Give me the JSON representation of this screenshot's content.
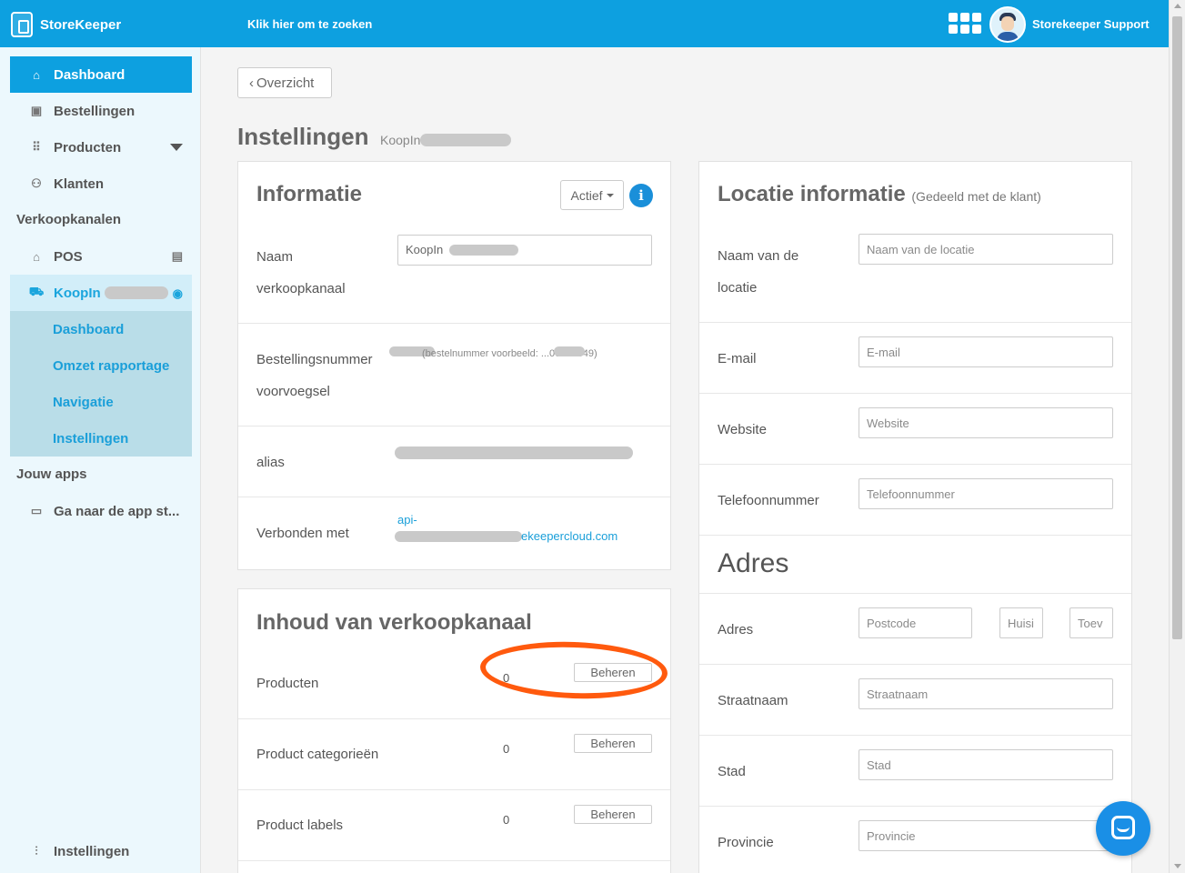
{
  "topbar": {
    "brand": "StoreKeeper",
    "search_link": "Klik hier om te zoeken",
    "user": "Storekeeper Support"
  },
  "sidebar": {
    "items": [
      {
        "label": "Dashboard",
        "icon": "home-icon"
      },
      {
        "label": "Bestellingen",
        "icon": "orders-icon"
      },
      {
        "label": "Producten",
        "icon": "grid-icon"
      },
      {
        "label": "Klanten",
        "icon": "users-icon"
      }
    ],
    "section_sales": "Verkoopkanalen",
    "pos": "POS",
    "channel": "KoopIn",
    "channel_sub": [
      "Dashboard",
      "Omzet rapportage",
      "Navigatie",
      "Instellingen"
    ],
    "section_apps": "Jouw apps",
    "app_store": "Ga naar de app st...",
    "settings": "Instellingen"
  },
  "main": {
    "back": "Overzicht",
    "title": "Instellingen",
    "subtitle": "KoopIn"
  },
  "info_panel": {
    "title": "Informatie",
    "status": "Actief",
    "name_label_1": "Naam",
    "name_label_2": "verkoopkanaal",
    "name_value": "KoopIn",
    "order_label_1": "Bestellingsnummer",
    "order_label_2": "voorvoegsel",
    "order_note": "(bestelnummer voorbeeld: ...00014849)",
    "alias_label": "alias",
    "connected_label": "Verbonden met",
    "connected_link_1": "api-",
    "connected_link_2": "ekeepercloud.com"
  },
  "content_panel": {
    "title": "Inhoud van verkoopkanaal",
    "rows": [
      {
        "label": "Producten",
        "count": "0",
        "action": "Beheren"
      },
      {
        "label": "Product categorieën",
        "count": "0",
        "action": "Beheren"
      },
      {
        "label": "Product labels",
        "count": "0",
        "action": "Beheren"
      }
    ]
  },
  "location_panel": {
    "title": "Locatie informatie",
    "title_note": "(Gedeeld met de klant)",
    "name_label_1": "Naam van de",
    "name_label_2": "locatie",
    "name_placeholder": "Naam van de locatie",
    "email_label": "E-mail",
    "email_placeholder": "E-mail",
    "website_label": "Website",
    "website_placeholder": "Website",
    "phone_label": "Telefoonnummer",
    "phone_placeholder": "Telefoonnummer",
    "address_heading": "Adres",
    "address_label": "Adres",
    "postcode_placeholder": "Postcode",
    "house_placeholder": "Huisi",
    "addition_placeholder": "Toev",
    "street_label": "Straatnaam",
    "street_placeholder": "Straatnaam",
    "city_label": "Stad",
    "city_placeholder": "Stad",
    "province_label": "Provincie",
    "province_placeholder": "Provincie"
  },
  "colors": {
    "accent": "#0da0e0",
    "annotation": "#ff5a0e"
  }
}
